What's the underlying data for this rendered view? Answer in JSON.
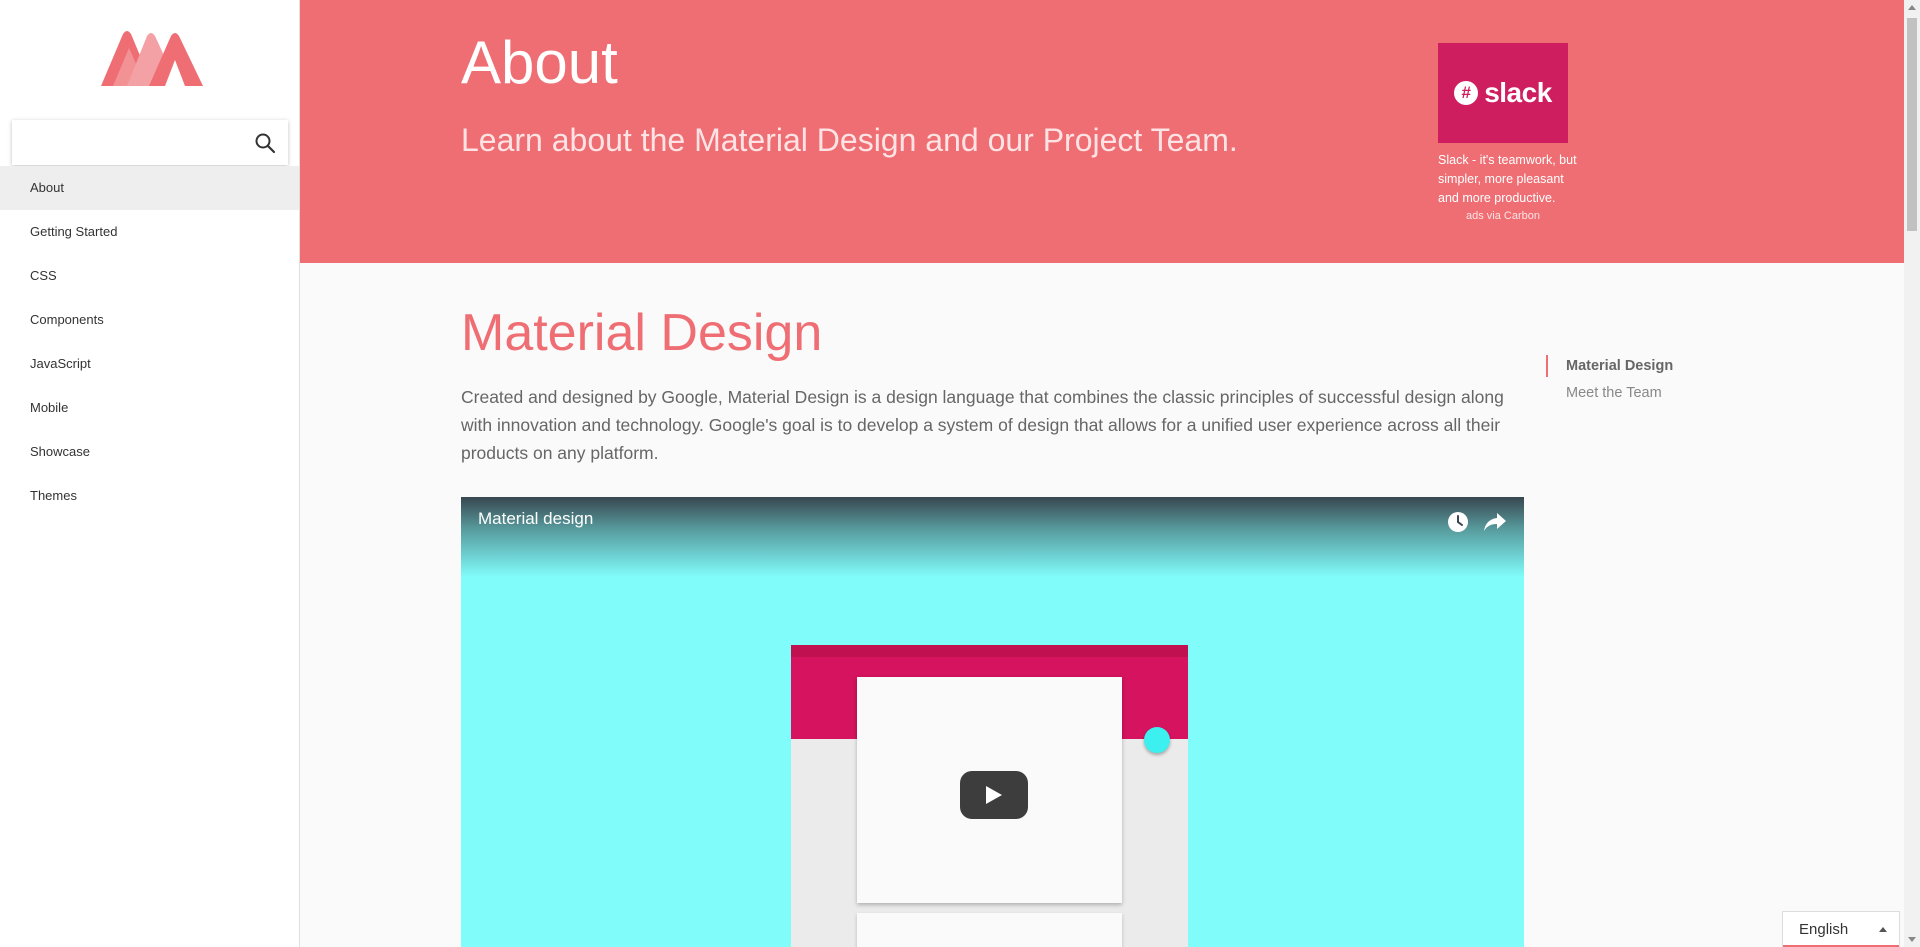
{
  "sidebar": {
    "search": {
      "value": "",
      "placeholder": ""
    },
    "items": [
      {
        "label": "About"
      },
      {
        "label": "Getting Started"
      },
      {
        "label": "CSS"
      },
      {
        "label": "Components"
      },
      {
        "label": "JavaScript"
      },
      {
        "label": "Mobile"
      },
      {
        "label": "Showcase"
      },
      {
        "label": "Themes"
      }
    ],
    "active_index": 0
  },
  "header": {
    "title": "About",
    "subtitle": "Learn about the Material Design and our Project Team.",
    "ad": {
      "brand": "slack",
      "text": "Slack - it's teamwork, but simpler, more pleasant and more productive.",
      "via": "ads via Carbon"
    }
  },
  "main": {
    "section_title": "Material Design",
    "intro": "Created and designed by Google, Material Design is a design language that combines the classic principles of successful design along with innovation and technology. Google's goal is to develop a system of design that allows for a unified user experience across all their products on any platform.",
    "video": {
      "title": "Material design"
    }
  },
  "toc": [
    {
      "label": "Material Design"
    },
    {
      "label": "Meet the Team"
    }
  ],
  "language": {
    "selected": "English"
  },
  "colors": {
    "accent": "#ee6e73",
    "slack": "#cf1e5f",
    "video_bg": "#80fcfb"
  },
  "icons": [
    "materialize-logo",
    "search-icon",
    "watch-later-icon",
    "share-icon",
    "play-icon",
    "caret-up-icon"
  ]
}
